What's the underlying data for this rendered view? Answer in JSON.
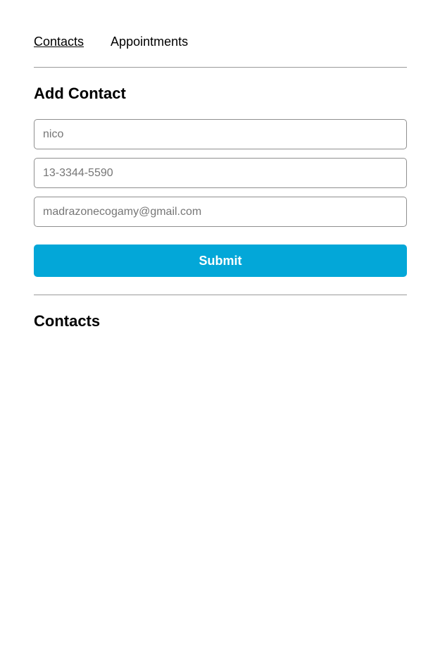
{
  "nav": {
    "contacts_label": "Contacts",
    "appointments_label": "Appointments"
  },
  "add_contact": {
    "title": "Add Contact",
    "name_placeholder": "nico",
    "phone_placeholder": "13-3344-5590",
    "email_placeholder": "madrazonecogamy@gmail.com",
    "submit_label": "Submit"
  },
  "contacts": {
    "title": "Contacts",
    "items": []
  },
  "colors": {
    "accent": "#03a7d8",
    "divider": "#9a9a9a",
    "field_border": "#8f8f8f"
  }
}
